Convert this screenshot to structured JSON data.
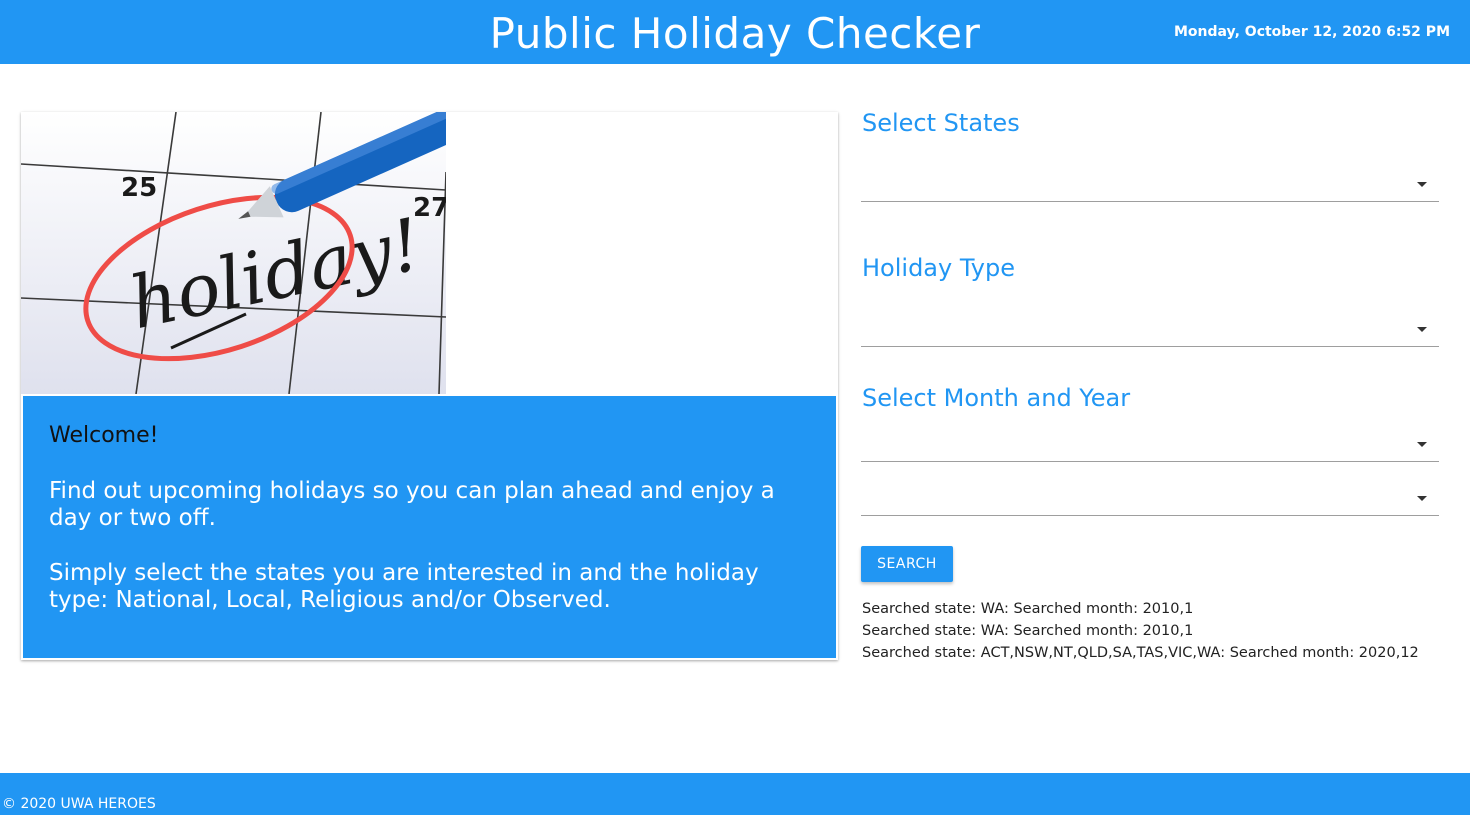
{
  "header": {
    "title": "Public Holiday Checker",
    "datetime": "Monday, October 12, 2020 6:52 PM"
  },
  "hero": {
    "image_alt": "Calendar with 'holiday!' circled in red and a blue pen",
    "image_text": {
      "day_left": "25",
      "day_right": "27",
      "word": "holiday!"
    }
  },
  "welcome": {
    "greeting": "Welcome!",
    "paragraph1": "Find out upcoming holidays so you can plan ahead and enjoy a day or two off.",
    "paragraph2": "Simply select the states you are interested in and the holiday type: National, Local, Religious and/or Observed."
  },
  "form": {
    "states_label": "Select States",
    "states_value": "",
    "type_label": "Holiday Type",
    "type_value": "",
    "monthyear_label": "Select Month and Year",
    "month_value": "",
    "year_value": "",
    "search_label": "SEARCH",
    "caret_icon": "caret-down-icon"
  },
  "history": [
    "Searched state: WA: Searched month: 2010,1",
    "Searched state: WA: Searched month: 2010,1",
    "Searched state: ACT,NSW,NT,QLD,SA,TAS,VIC,WA: Searched month: 2020,12"
  ],
  "footer": {
    "copyright": "© 2020 UWA HEROES"
  },
  "colors": {
    "primary": "#2196f3",
    "text_dark": "#222222",
    "white": "#ffffff"
  }
}
